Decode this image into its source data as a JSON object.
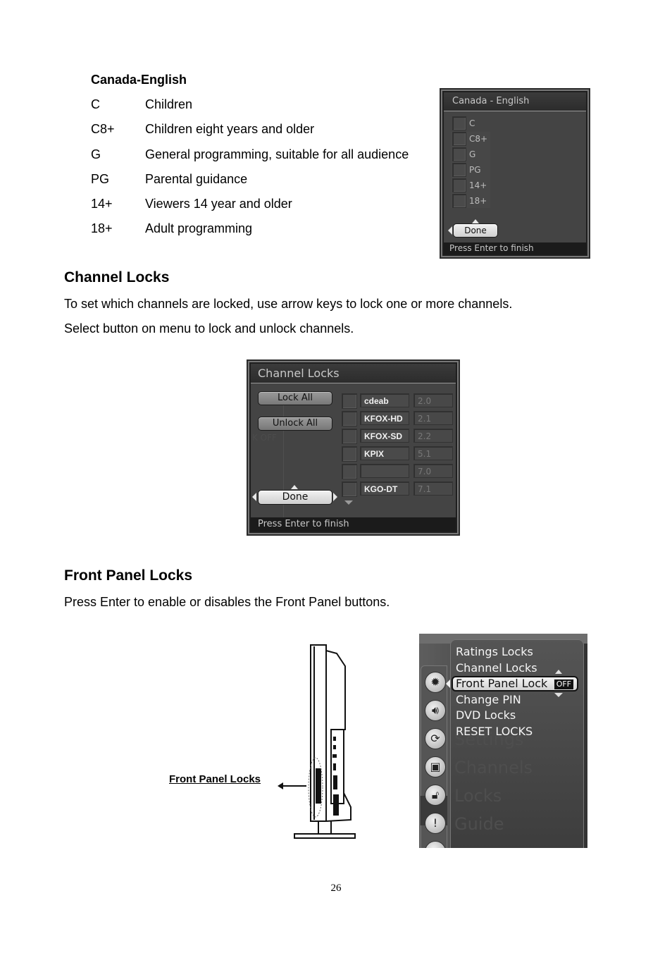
{
  "ratings_section": {
    "title": "Canada-English",
    "rows": [
      {
        "code": "C",
        "description": "Children"
      },
      {
        "code": "C8+",
        "description": "Children eight years and older"
      },
      {
        "code": "G",
        "description": "General programming, suitable for all audience"
      },
      {
        "code": "PG",
        "description": "Parental guidance"
      },
      {
        "code": "14+",
        "description": "Viewers 14 year and older"
      },
      {
        "code": "18+",
        "description": "Adult programming"
      }
    ]
  },
  "canada_osd": {
    "title": "Canada - English",
    "items": [
      "C",
      "C8+",
      "G",
      "PG",
      "14+",
      "18+"
    ],
    "done_label": "Done",
    "footer": "Press Enter to finish"
  },
  "channel_locks_section": {
    "heading": "Channel Locks",
    "para1": "To set which channels are locked, use arrow keys to lock one or more channels.",
    "para2": "Select button on menu to lock and unlock channels."
  },
  "channel_osd": {
    "title": "Channel Locks",
    "lock_all_label": "Lock All",
    "unlock_all_label": "Unlock All",
    "ghost_text": "K OFF",
    "done_label": "Done",
    "footer": "Press Enter to finish",
    "channels": [
      {
        "name": "cdeab",
        "number": "2.0"
      },
      {
        "name": "KFOX-HD",
        "number": "2.1"
      },
      {
        "name": "KFOX-SD",
        "number": "2.2"
      },
      {
        "name": "KPIX",
        "number": "5.1"
      },
      {
        "name": "",
        "number": "7.0"
      },
      {
        "name": "KGO-DT",
        "number": "7.1"
      }
    ]
  },
  "front_panel_section": {
    "heading": "Front Panel Locks",
    "para": "Press Enter to enable or disables the Front Panel buttons.",
    "diagram_label": "Front Panel Locks"
  },
  "front_panel_osd": {
    "menu_items": [
      "Ratings Locks",
      "Channel Locks",
      "Front Panel Lock",
      "Change PIN",
      "DVD Locks",
      "RESET LOCKS"
    ],
    "selected_index": 2,
    "selected_value": "OFF",
    "ghost_labels": [
      "Settings",
      "Channels",
      "Locks",
      "Guide"
    ],
    "side_icons": [
      "gear-icon",
      "speaker-icon",
      "refresh-icon",
      "tv-icon",
      "lock-icon",
      "alert-icon"
    ]
  },
  "footer": {
    "page_number": "26"
  }
}
